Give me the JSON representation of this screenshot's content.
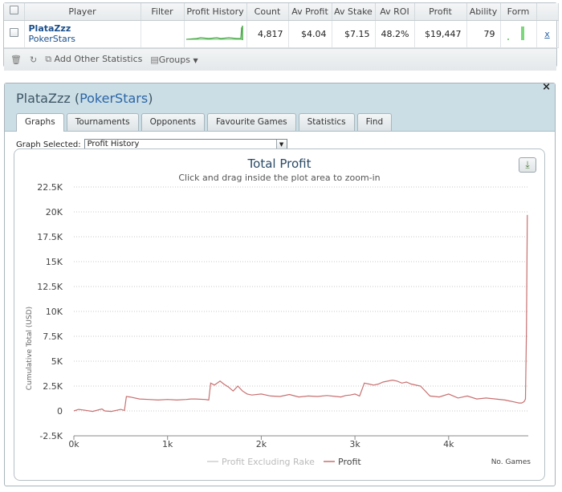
{
  "stats_table": {
    "headers": [
      "Player",
      "Filter",
      "Profit History",
      "Count",
      "Av Profit",
      "Av Stake",
      "Av ROI",
      "Profit",
      "Ability",
      "Form"
    ],
    "row": {
      "player_name": "PlataZzz",
      "site": "PokerStars",
      "filter": "",
      "count": "4,817",
      "av_profit": "$4.04",
      "av_stake": "$7.15",
      "av_roi": "48.2%",
      "profit": "$19,447",
      "ability": "79",
      "remove_label": "x"
    }
  },
  "toolbar": {
    "add_stats_label": "Add Other Statistics",
    "groups_label": "Groups"
  },
  "window": {
    "player_name": "PlataZzz",
    "site_open": " (",
    "site": "PokerStars",
    "site_close": ")",
    "close_label": "×",
    "tabs": [
      "Graphs",
      "Tournaments",
      "Opponents",
      "Favourite Games",
      "Statistics",
      "Find"
    ],
    "active_tab": "Graphs",
    "graph_selected_label": "Graph Selected:",
    "graph_selected_value": "Profit History",
    "download_icon": "download-icon"
  },
  "chart_data": {
    "type": "line",
    "title": "Total Profit",
    "subtitle": "Click and drag inside the plot area to zoom-in",
    "ylabel": "Cumulative Total (USD)",
    "xlabel": "No. Games",
    "ylim": [
      -2500,
      22500
    ],
    "xlim": [
      0,
      4850
    ],
    "y_ticks": [
      -2500,
      0,
      2500,
      5000,
      7500,
      10000,
      12500,
      15000,
      17500,
      20000,
      22500
    ],
    "y_tick_labels": [
      "-2.5K",
      "0",
      "2.5K",
      "5K",
      "7.5K",
      "10K",
      "12.5K",
      "15K",
      "17.5K",
      "20K",
      "22.5K"
    ],
    "x_ticks": [
      0,
      1000,
      2000,
      3000,
      4000
    ],
    "x_tick_labels": [
      "0k",
      "1k",
      "2k",
      "3k",
      "4k"
    ],
    "grid": "horizontal dotted",
    "legend_position": "bottom",
    "legend": [
      "Profit Excluding Rake",
      "Profit"
    ],
    "colors": {
      "profit": "#c97070",
      "profit_excl_rake": "#cfcfcf"
    },
    "series": [
      {
        "name": "Profit",
        "x": [
          0,
          50,
          100,
          200,
          300,
          330,
          400,
          500,
          540,
          560,
          600,
          700,
          800,
          900,
          1000,
          1100,
          1200,
          1250,
          1300,
          1400,
          1440,
          1460,
          1500,
          1560,
          1600,
          1650,
          1700,
          1750,
          1800,
          1850,
          1900,
          2000,
          2100,
          2200,
          2300,
          2400,
          2500,
          2600,
          2700,
          2800,
          2850,
          2900,
          2950,
          3000,
          3050,
          3100,
          3150,
          3200,
          3250,
          3300,
          3400,
          3450,
          3500,
          3550,
          3600,
          3700,
          3800,
          3900,
          4000,
          4100,
          4200,
          4300,
          4400,
          4500,
          4600,
          4650,
          4700,
          4750,
          4780,
          4800,
          4810,
          4820,
          4830,
          4840
        ],
        "values": [
          0,
          150,
          100,
          -50,
          200,
          0,
          -50,
          150,
          50,
          1450,
          1400,
          1200,
          1150,
          1100,
          1150,
          1100,
          1150,
          1200,
          1200,
          1150,
          1100,
          2800,
          2600,
          3000,
          2700,
          2400,
          2000,
          2500,
          2000,
          1700,
          1600,
          1700,
          1500,
          1450,
          1650,
          1400,
          1500,
          1450,
          1550,
          1450,
          1400,
          1550,
          1600,
          1700,
          1500,
          2800,
          2700,
          2600,
          2700,
          2900,
          3100,
          3000,
          2800,
          2900,
          2700,
          2500,
          1500,
          1400,
          1700,
          1300,
          1500,
          1200,
          1300,
          1200,
          1100,
          1000,
          900,
          800,
          800,
          900,
          1000,
          1200,
          8000,
          19700
        ]
      }
    ]
  }
}
